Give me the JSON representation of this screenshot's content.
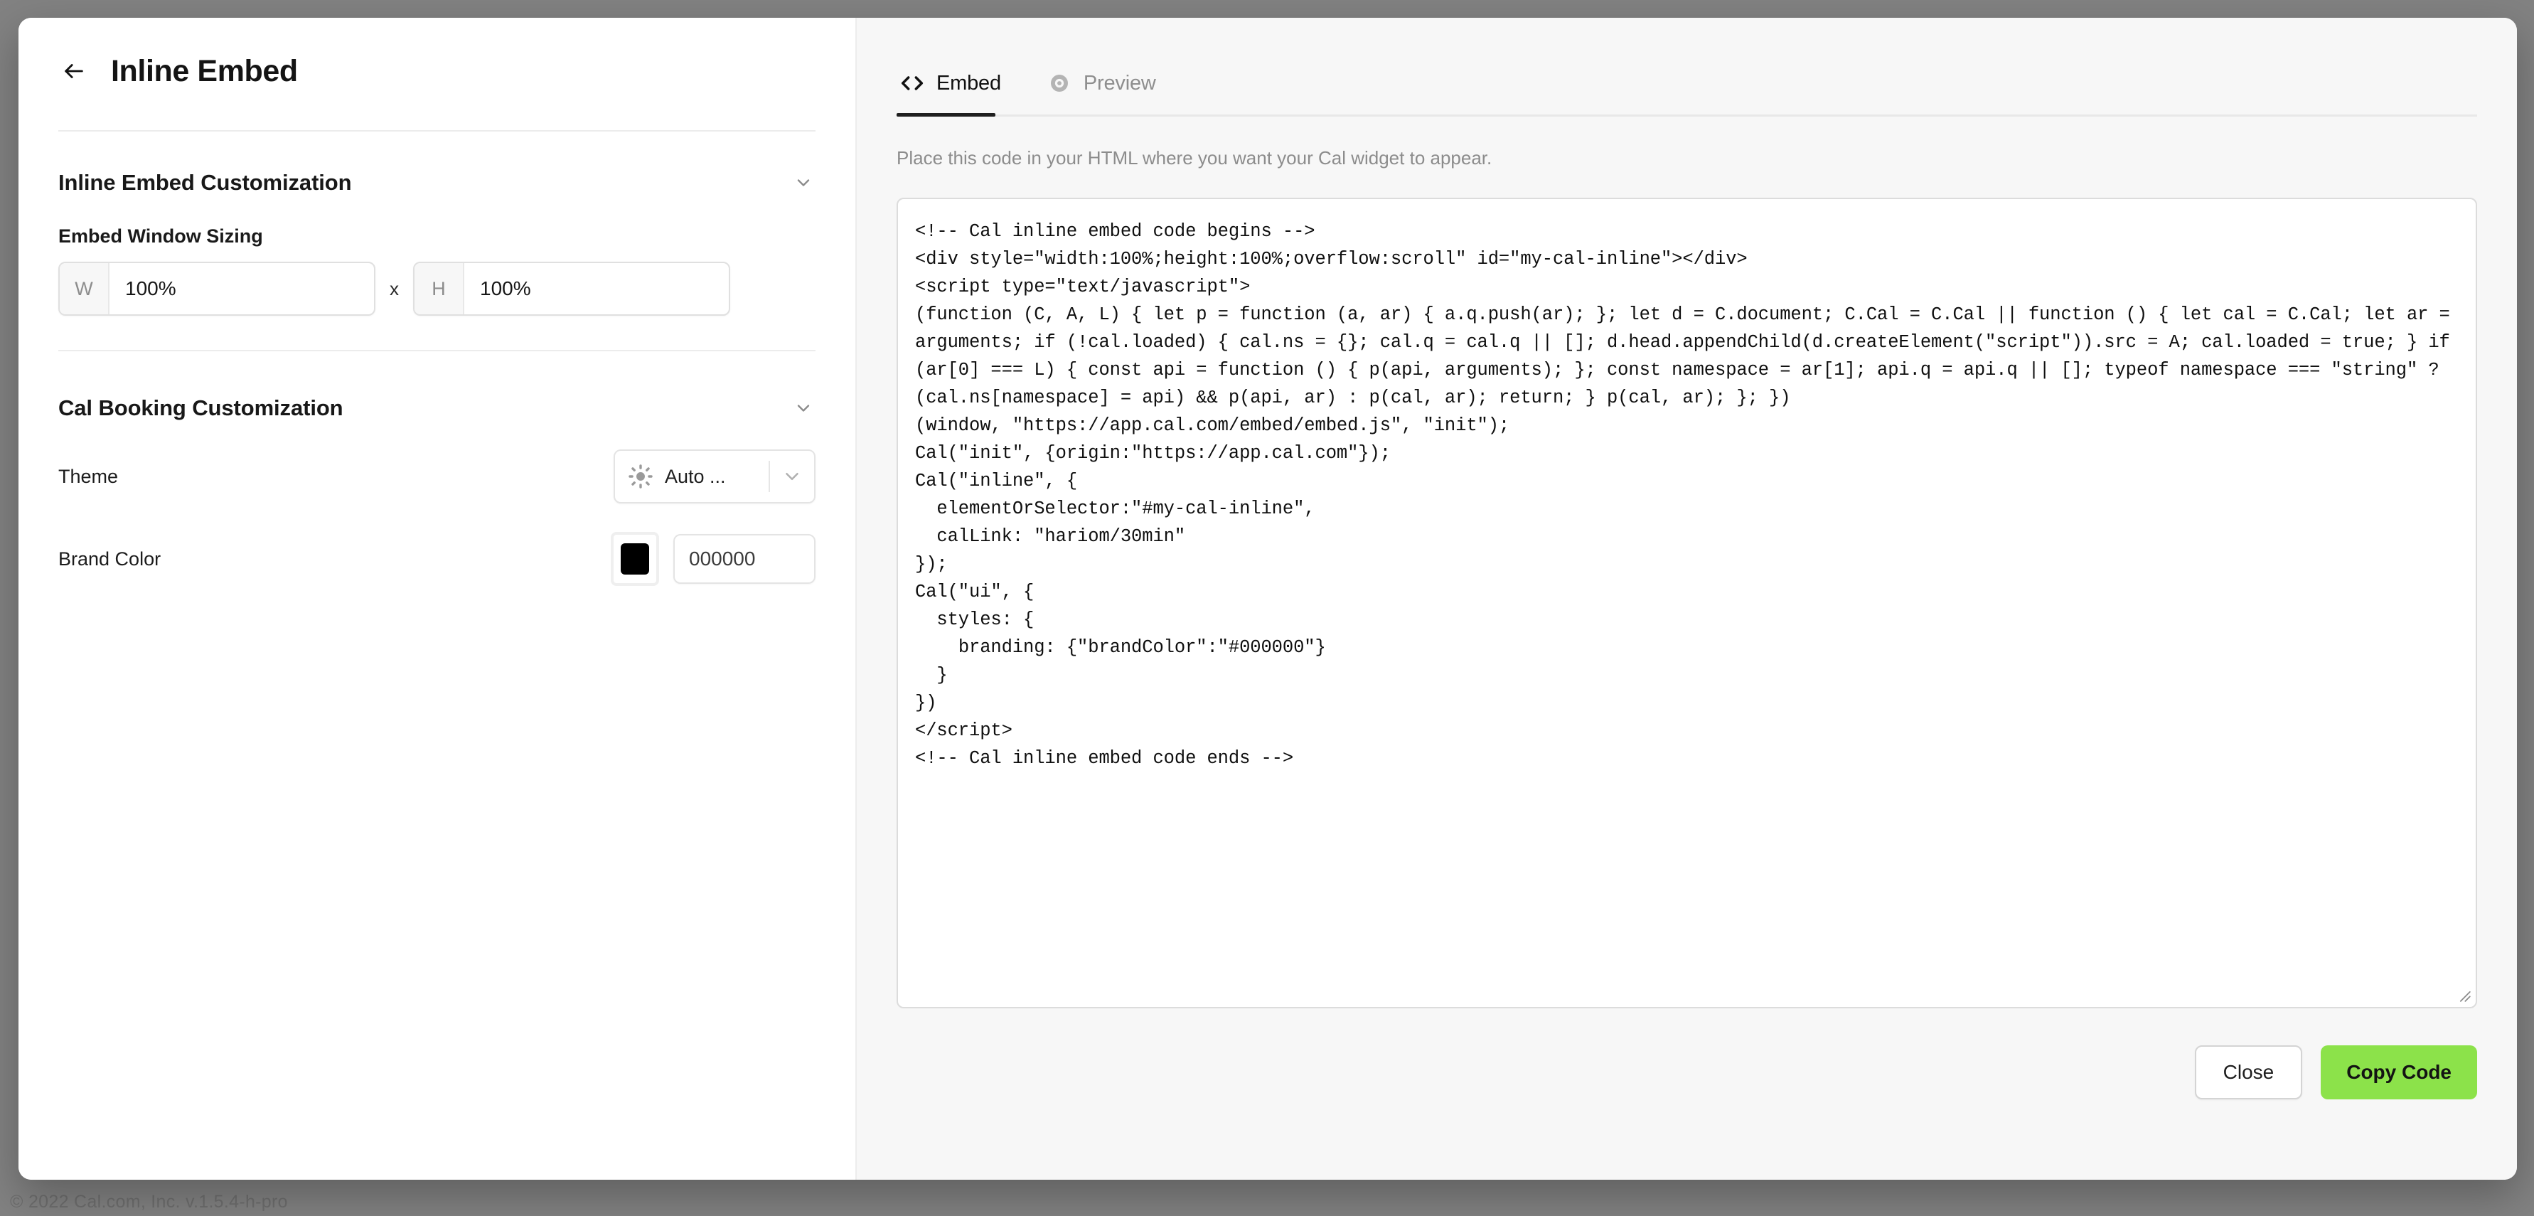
{
  "backdrop": {
    "footer_text": "© 2022 Cal.com, Inc. v.1.5.4-h-pro"
  },
  "dialog": {
    "title": "Inline Embed",
    "back_icon": "arrow-left-icon"
  },
  "left_panel": {
    "sections": [
      {
        "title": "Inline Embed Customization",
        "chevron": "chevron-down-icon"
      },
      {
        "title": "Cal Booking Customization",
        "chevron": "chevron-down-icon"
      }
    ],
    "sizing": {
      "label": "Embed Window Sizing",
      "width_prefix": "W",
      "width_value": "100%",
      "width_placeholder": "100%",
      "separator": "x",
      "height_prefix": "H",
      "height_value": "100%",
      "height_placeholder": "100%"
    },
    "theme": {
      "label": "Theme",
      "icon": "sun-icon",
      "value": "Auto ...",
      "chevron": "chevron-down-icon"
    },
    "brand_color": {
      "label": "Brand Color",
      "swatch_color": "#000000",
      "hex_value": "000000",
      "hex_placeholder": "000000"
    }
  },
  "right_panel": {
    "tabs": [
      {
        "label": "Embed",
        "icon": "code-icon",
        "active": true
      },
      {
        "label": "Preview",
        "icon": "eye-icon",
        "active": false
      }
    ],
    "hint": "Place this code in your HTML where you want your Cal widget to appear.",
    "code": "<!-- Cal inline embed code begins -->\n<div style=\"width:100%;height:100%;overflow:scroll\" id=\"my-cal-inline\"></div>\n<script type=\"text/javascript\">\n(function (C, A, L) { let p = function (a, ar) { a.q.push(ar); }; let d = C.document; C.Cal = C.Cal || function () { let cal = C.Cal; let ar = arguments; if (!cal.loaded) { cal.ns = {}; cal.q = cal.q || []; d.head.appendChild(d.createElement(\"script\")).src = A; cal.loaded = true; } if (ar[0] === L) { const api = function () { p(api, arguments); }; const namespace = ar[1]; api.q = api.q || []; typeof namespace === \"string\" ? (cal.ns[namespace] = api) && p(api, ar) : p(cal, ar); return; } p(cal, ar); }; })\n(window, \"https://app.cal.com/embed/embed.js\", \"init\");\nCal(\"init\", {origin:\"https://app.cal.com\"});\nCal(\"inline\", {\n  elementOrSelector:\"#my-cal-inline\",\n  calLink: \"hariom/30min\"\n});\nCal(\"ui\", {\n  styles: {\n    branding: {\"brandColor\":\"#000000\"}\n  }\n})\n</script>\n<!-- Cal inline embed code ends -->",
    "resize_grip": "resize-handle-icon",
    "buttons": {
      "close": "Close",
      "copy": "Copy Code",
      "copy_color": "#8ce24a"
    }
  }
}
